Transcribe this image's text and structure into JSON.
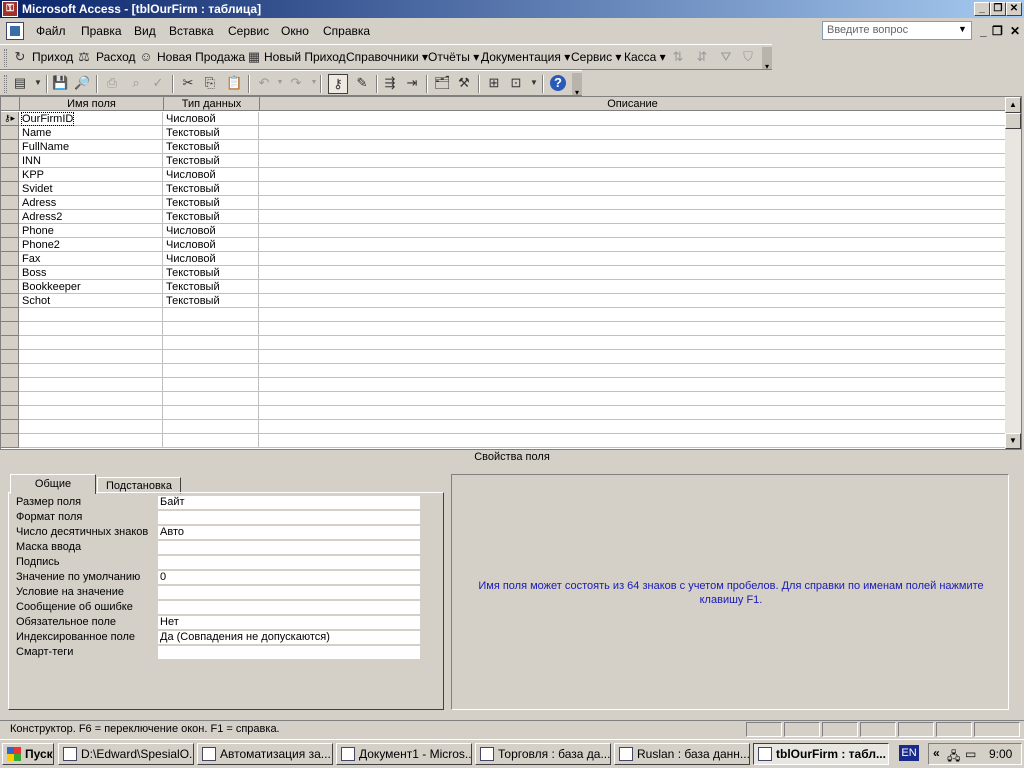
{
  "window": {
    "title": "Microsoft Access - [tblOurFirm : таблица]"
  },
  "menu": {
    "items": [
      "Файл",
      "Правка",
      "Вид",
      "Вставка",
      "Сервис",
      "Окно",
      "Справка"
    ],
    "ask_placeholder": "Введите вопрос"
  },
  "toolbar1": {
    "items": [
      "Приход",
      "Расход",
      "Новая Продажа",
      "Новый Приход",
      "Справочники",
      "Отчёты",
      "Документация",
      "Сервис",
      "Касса"
    ]
  },
  "grid": {
    "headers": [
      "Имя поля",
      "Тип данных",
      "Описание"
    ],
    "rows": [
      {
        "name": "OurFirmID",
        "type": "Числовой"
      },
      {
        "name": "Name",
        "type": "Текстовый"
      },
      {
        "name": "FullName",
        "type": "Текстовый"
      },
      {
        "name": "INN",
        "type": "Текстовый"
      },
      {
        "name": "KPP",
        "type": "Числовой"
      },
      {
        "name": "Svidet",
        "type": "Текстовый"
      },
      {
        "name": "Adress",
        "type": "Текстовый"
      },
      {
        "name": "Adress2",
        "type": "Текстовый"
      },
      {
        "name": "Phone",
        "type": "Числовой"
      },
      {
        "name": "Phone2",
        "type": "Числовой"
      },
      {
        "name": "Fax",
        "type": "Числовой"
      },
      {
        "name": "Boss",
        "type": "Текстовый"
      },
      {
        "name": "Bookkeeper",
        "type": "Текстовый"
      },
      {
        "name": "Schot",
        "type": "Текстовый"
      }
    ]
  },
  "properties": {
    "section_label": "Свойства поля",
    "tabs": [
      "Общие",
      "Подстановка"
    ],
    "rows": [
      {
        "label": "Размер поля",
        "value": "Байт"
      },
      {
        "label": "Формат поля",
        "value": ""
      },
      {
        "label": "Число десятичных знаков",
        "value": "Авто"
      },
      {
        "label": "Маска ввода",
        "value": ""
      },
      {
        "label": "Подпись",
        "value": ""
      },
      {
        "label": "Значение по умолчанию",
        "value": "0"
      },
      {
        "label": "Условие на значение",
        "value": ""
      },
      {
        "label": "Сообщение об ошибке",
        "value": ""
      },
      {
        "label": "Обязательное поле",
        "value": "Нет"
      },
      {
        "label": "Индексированное поле",
        "value": "Да (Совпадения не допускаются)"
      },
      {
        "label": "Смарт-теги",
        "value": ""
      }
    ],
    "help_text": "Имя поля может состоять из 64 знаков с учетом пробелов.  Для справки по именам полей нажмите клавишу F1."
  },
  "status": {
    "text": "Конструктор.  F6 = переключение окон.  F1 = справка."
  },
  "taskbar": {
    "start": "Пуск",
    "tasks": [
      "D:\\Edward\\SpesialO...",
      "Автоматизация за...",
      "Документ1 - Micros...",
      "Торговля : база да...",
      "Ruslan : база данн...",
      "tblOurFirm : табл..."
    ],
    "lang": "EN",
    "clock": "9:00"
  },
  "colors": {
    "title_start": "#0a246a",
    "title_end": "#a6caf0",
    "help_text": "#1a1ab4",
    "chrome": "#d4d0c8"
  }
}
